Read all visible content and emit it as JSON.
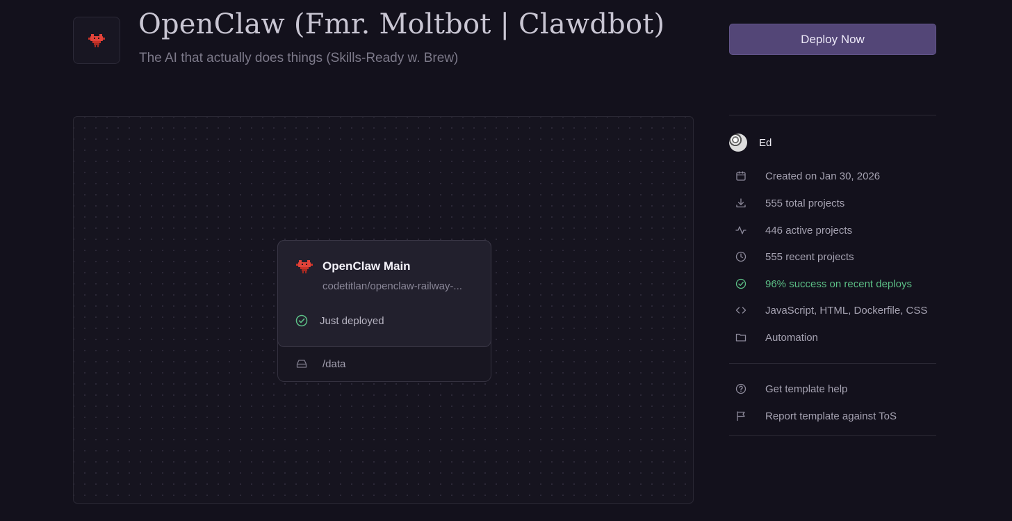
{
  "header": {
    "title": "OpenClaw (Fmr. Moltbot | Clawdbot)",
    "subtitle": "The AI that actually does things (Skills-Ready w. Brew)",
    "deploy_label": "Deploy Now",
    "logo_icon": "red-lobster-logo"
  },
  "canvas": {
    "service": {
      "name": "OpenClaw Main",
      "repo": "codetitlan/openclaw-railway-...",
      "status": "Just deployed",
      "volume": "/data"
    }
  },
  "sidebar": {
    "author": "Ed",
    "meta": {
      "created": "Created on Jan 30, 2026",
      "total": "555 total projects",
      "active": "446 active projects",
      "recent": "555 recent projects",
      "success": "96% success on recent deploys",
      "languages": "JavaScript, HTML, Dockerfile, CSS",
      "category": "Automation"
    },
    "links": {
      "help": "Get template help",
      "report": "Report template against ToS"
    }
  },
  "colors": {
    "background": "#13111c",
    "accent": "#534677",
    "success": "#5cbf86",
    "logo": "#e2433a"
  }
}
